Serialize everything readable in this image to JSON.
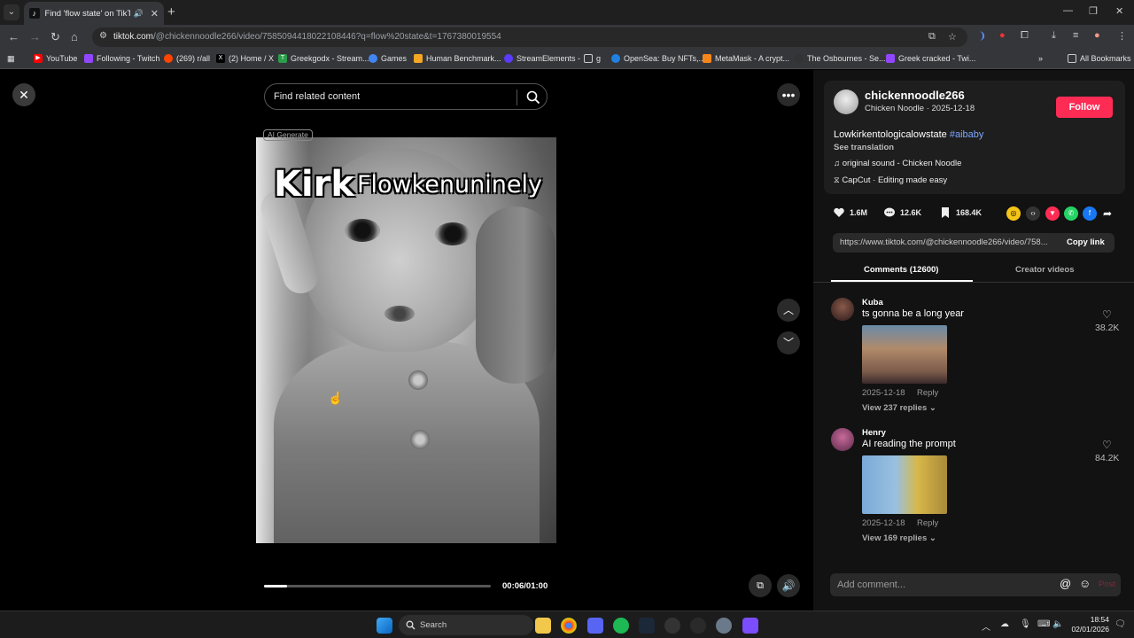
{
  "browser": {
    "tab_title": "Find 'flow state' on TikTok |",
    "url_host": "tiktok.com",
    "url_path": "/@chickennoodle266/video/7585094418022108446?q=flow%20state&t=1767380019554",
    "bookmarks": [
      "YouTube",
      "Following - Twitch",
      "(269) r/all",
      "(2) Home / X",
      "Greekgodx - Stream...",
      "Games",
      "Human Benchmark...",
      "StreamElements -",
      "g",
      "OpenSea: Buy NFTs,...",
      "MetaMask - A crypt...",
      "The Osbournes - Se...",
      "Greek cracked - Twi...",
      "All Bookmarks"
    ]
  },
  "player": {
    "search_placeholder": "Find related content",
    "ai_badge": "AI Generate",
    "caption_left": "Kirk",
    "caption_right": "Flowkenuninely",
    "time": "00:06/01:00",
    "progress": 0.1
  },
  "creator": {
    "username": "chickennoodle266",
    "subline": "Chicken Noodle · 2025-12-18",
    "follow": "Follow",
    "description": "Lowkirkentologicalowstate",
    "hashtag": "#aibaby",
    "see_translation": "See translation",
    "sound": "original sound - Chicken Noodle",
    "capcut": "CapCut · Editing made easy"
  },
  "stats": {
    "likes": "1.6M",
    "comments": "12.6K",
    "saves": "168.4K"
  },
  "link": {
    "url": "https://www.tiktok.com/@chickennoodle266/video/758...",
    "copy": "Copy link"
  },
  "tabs": {
    "comments": "Comments (12600)",
    "creator_videos": "Creator videos"
  },
  "comments": [
    {
      "name": "Kuba",
      "text": "ts gonna be a long year",
      "date": "2025-12-18",
      "reply": "Reply",
      "view_replies": "View 237 replies",
      "likes": "38.2K"
    },
    {
      "name": "Henry",
      "text": "AI reading the prompt",
      "date": "2025-12-18",
      "reply": "Reply",
      "view_replies": "View 169 replies",
      "likes": "84.2K"
    }
  ],
  "add_comment": {
    "placeholder": "Add comment...",
    "post": "Post"
  },
  "taskbar": {
    "search": "Search",
    "time": "18:54",
    "date": "02/01/2026"
  },
  "colors": {
    "accent": "#fe2c55",
    "hashtag": "#7ea7ff"
  }
}
